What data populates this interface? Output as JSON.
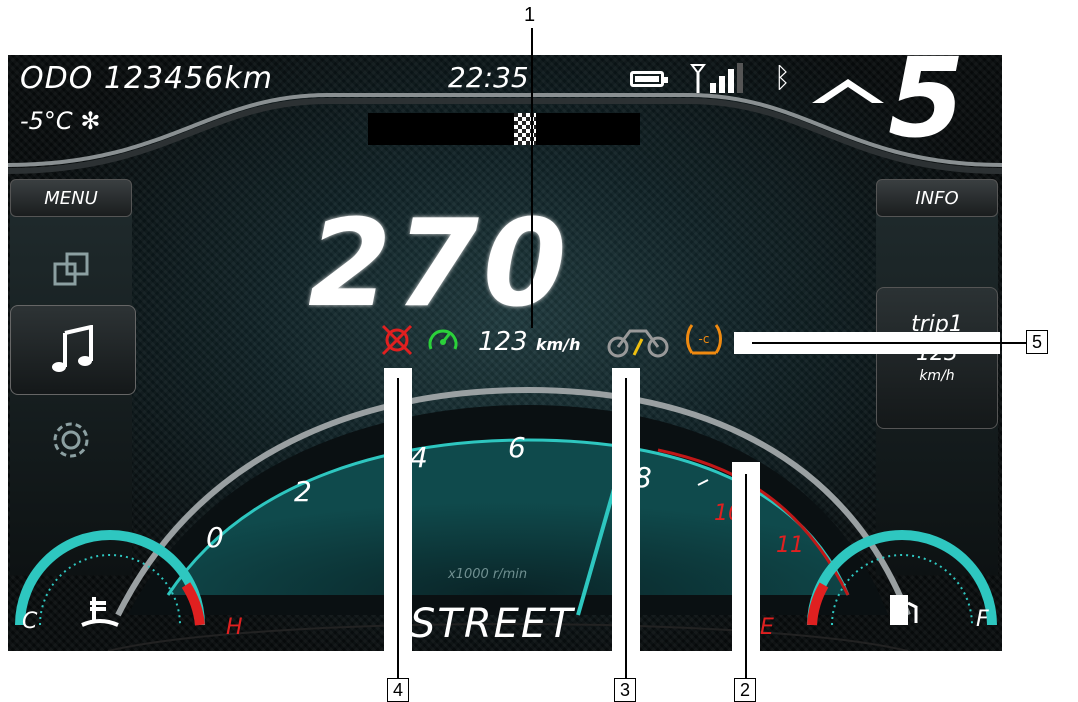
{
  "status_bar": {
    "odometer": "ODO 123456km",
    "outside_temp": "-5°C",
    "clock": "22:35",
    "gear": "5"
  },
  "left_menu": {
    "menu_label": "MENU",
    "items": [
      "window-switch-icon",
      "music-icon",
      "settings-icon"
    ]
  },
  "right_menu": {
    "info_label": "INFO",
    "trip_label": "trip1",
    "trip_value": "123",
    "trip_unit": "km/h"
  },
  "main": {
    "speed": "270",
    "cruise_speed": "123",
    "cruise_unit": "km/h",
    "mode": "STREET",
    "rpm_unit": "x1000 r/min",
    "tacho_labels": [
      "0",
      "2",
      "4",
      "6",
      "8",
      "10",
      "11"
    ],
    "temp_low": "C",
    "temp_high": "H",
    "fuel_empty": "E",
    "fuel_full": "F"
  },
  "callouts": {
    "c1": "1",
    "c2": "2",
    "c3": "3",
    "c4": "4",
    "c5": "5"
  },
  "colors": {
    "accent": "#2ec7c0",
    "warning_red": "#e02020",
    "cruise_green": "#2bd13a",
    "tire_orange": "#f08a10"
  }
}
